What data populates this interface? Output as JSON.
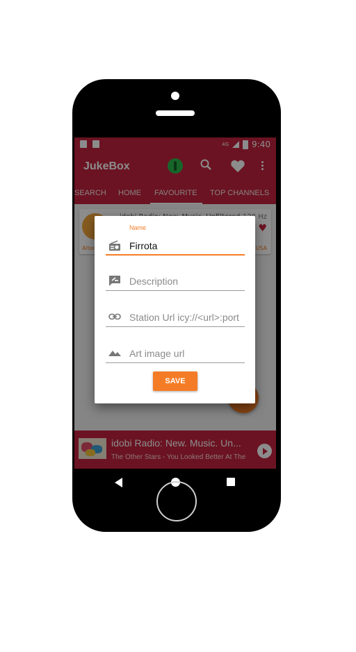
{
  "status_bar": {
    "time": "9:40",
    "network": "4G"
  },
  "app_bar": {
    "title": "JukeBox"
  },
  "tabs": [
    {
      "label": "SEARCH"
    },
    {
      "label": "HOME"
    },
    {
      "label": "FAVOURITE"
    },
    {
      "label": "TOP CHANNELS"
    }
  ],
  "active_tab": "FAVOURITE",
  "card": {
    "title": "idobi Radio: New. Music. Unfiltered.",
    "hz": "128 Hz",
    "genre_left": "Alternative",
    "genre_right": "USA"
  },
  "dialog": {
    "name_label": "Name",
    "name_value": "Firrota",
    "description_placeholder": "Description",
    "station_url_placeholder": "Station Url icy://<url>:port",
    "art_placeholder": "Art image url",
    "save_label": "SAVE"
  },
  "player": {
    "title": "idobi Radio: New. Music. Un...",
    "subtitle": "The Other Stars - You Looked Better At The"
  },
  "colors": {
    "primary": "#c4243e",
    "accent": "#f57c26",
    "fab_green": "#2db84d"
  },
  "icons": [
    "radio-icon",
    "description-icon",
    "link-icon",
    "image-icon",
    "search-icon",
    "heart-icon",
    "more-vert-icon",
    "play-icon"
  ]
}
